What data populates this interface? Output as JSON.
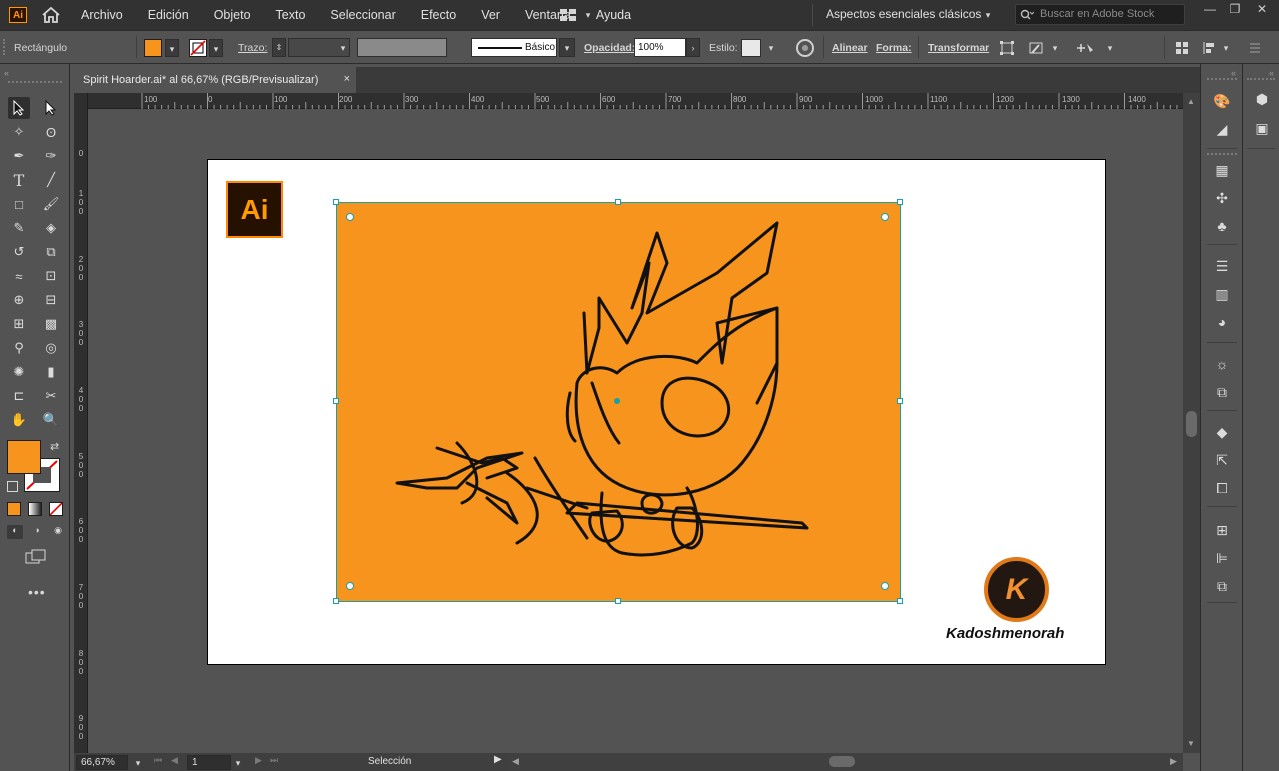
{
  "app": {
    "logo_text": "Ai"
  },
  "menubar": {
    "items": [
      "Archivo",
      "Edición",
      "Objeto",
      "Texto",
      "Seleccionar",
      "Efecto",
      "Ver",
      "Ventana",
      "Ayuda"
    ],
    "workspace": "Aspectos esenciales clásicos",
    "search_placeholder": "Buscar en Adobe Stock"
  },
  "controlbar": {
    "object_type": "Rectángulo",
    "stroke_label": "Trazo:",
    "brush_label": "Básico",
    "opacity_label": "Opacidad:",
    "opacity_value": "100%",
    "style_label": "Estilo:",
    "align_label": "Alinear",
    "shape_label": "Forma:",
    "transform_label": "Transformar",
    "fill_color": "#f7941d"
  },
  "document": {
    "tab_title": "Spirit Hoarder.ai* al 66,67% (RGB/Previsualizar)",
    "tab_close": "×"
  },
  "rulers": {
    "horizontal": [
      "100",
      "0",
      "100",
      "200",
      "300",
      "400",
      "500",
      "600",
      "700",
      "800",
      "900",
      "1000",
      "1100",
      "1200",
      "1300",
      "1400"
    ],
    "vertical": [
      "0",
      "1\n0\n0",
      "2\n0\n0",
      "3\n0\n0",
      "4\n0\n0",
      "5\n0\n0",
      "6\n0\n0",
      "7\n0\n0",
      "8\n0\n0",
      "9\n0\n0"
    ]
  },
  "artwork": {
    "ai_badge": "Ai",
    "brand_initial": "K",
    "brand_name": "Kadoshmenorah",
    "accent": "#f7941d",
    "selection_color": "#18a0a8"
  },
  "statusbar": {
    "zoom": "66,67%",
    "artboard_number": "1",
    "tool_name": "Selección"
  }
}
